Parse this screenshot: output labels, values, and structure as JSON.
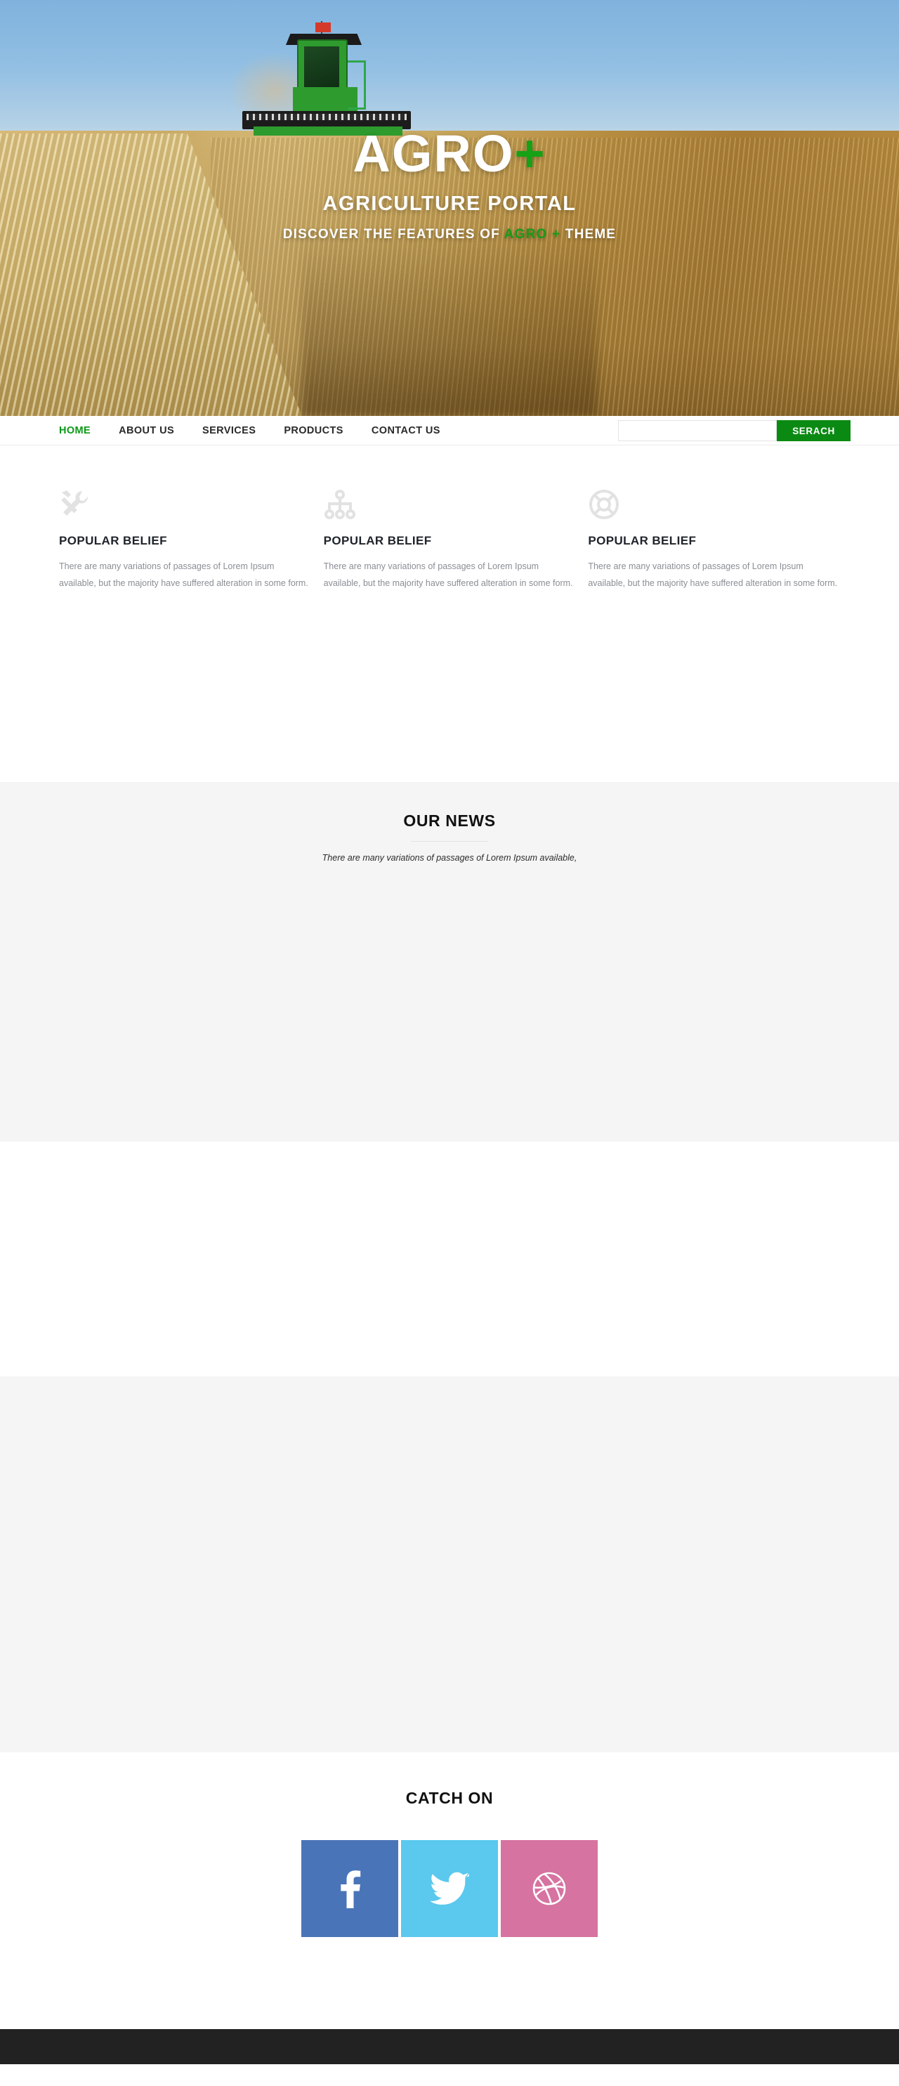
{
  "hero": {
    "brand_main": "AGRO",
    "brand_plus": "+",
    "tagline": "AGRICULTURE PORTAL",
    "subline_before": "DISCOVER THE FEATURES OF ",
    "subline_highlight": "AGRO +",
    "subline_after": " THEME",
    "image_alt": "green-combine-harvester-in-wheat-field",
    "overlay_text_color": "#ffffff",
    "accent_color": "#16a116"
  },
  "nav": {
    "items": [
      {
        "label": "HOME",
        "active": true
      },
      {
        "label": "ABOUT US",
        "active": false
      },
      {
        "label": "SERVICES",
        "active": false
      },
      {
        "label": "PRODUCTS",
        "active": false
      },
      {
        "label": "CONTACT US",
        "active": false
      }
    ],
    "active_color": "#0a9a14",
    "link_color": "#2a2a2a"
  },
  "search": {
    "value": "",
    "placeholder": "",
    "button_label": "SERACH",
    "button_color": "#0b8a13"
  },
  "features": [
    {
      "icon": "tools-icon",
      "title": "POPULAR BELIEF",
      "text": "There are many variations of passages of Lorem Ipsum available, but the majority have suffered alteration in some form."
    },
    {
      "icon": "sitemap-icon",
      "title": "POPULAR BELIEF",
      "text": "There are many variations of passages of Lorem Ipsum available, but the majority have suffered alteration in some form."
    },
    {
      "icon": "life-ring-icon",
      "title": "POPULAR BELIEF",
      "text": "There are many variations of passages of Lorem Ipsum available, but the majority have suffered alteration in some form."
    }
  ],
  "news": {
    "title": "OUR NEWS",
    "subtitle": "There are many variations of passages of Lorem Ipsum available,",
    "background": "#f5f5f5"
  },
  "catch_on": {
    "title": "CATCH ON",
    "socials": [
      {
        "name": "facebook",
        "icon": "facebook-icon",
        "color": "#4a74b8"
      },
      {
        "name": "twitter",
        "icon": "twitter-icon",
        "color": "#5bc8ee"
      },
      {
        "name": "dribbble",
        "icon": "dribbble-icon",
        "color": "#d673a0"
      }
    ]
  },
  "footer": {
    "background": "#222222"
  }
}
